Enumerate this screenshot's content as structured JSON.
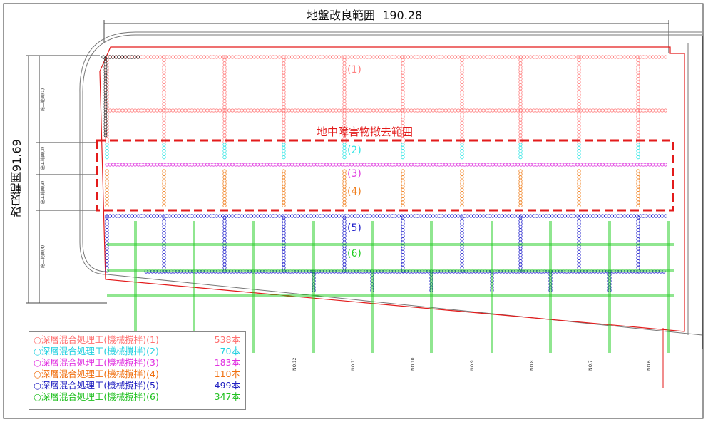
{
  "title": {
    "width_label": "地盤改良範囲",
    "width_value": "190.28"
  },
  "side_label": "改良範囲91.69",
  "obstacle_label": "地中障害物撤去範囲",
  "zones": [
    {
      "label": "(1)",
      "color": "#ff8080"
    },
    {
      "label": "(2)",
      "color": "#33e5e5"
    },
    {
      "label": "(3)",
      "color": "#e040e0"
    },
    {
      "label": "(4)",
      "color": "#f08020"
    },
    {
      "label": "(5)",
      "color": "#2222cc"
    },
    {
      "label": "(6)",
      "color": "#22cc22"
    }
  ],
  "legend": [
    {
      "label": "○深層混合処理工(機械撹拌)(1)",
      "count": "538本",
      "color": "#ff7070"
    },
    {
      "label": "○深層混合処理工(機械撹拌)(2)",
      "count": "70本",
      "color": "#22d0e0"
    },
    {
      "label": "○深層混合処理工(機械撹拌)(3)",
      "count": "183本",
      "color": "#e030e0"
    },
    {
      "label": "○深層混合処理工(機械撹拌)(4)",
      "count": "110本",
      "color": "#f07010"
    },
    {
      "label": "○深層混合処理工(機械撹拌)(5)",
      "count": "499本",
      "color": "#2020c0"
    },
    {
      "label": "○深層混合処理工(機械撹拌)(6)",
      "count": "347本",
      "color": "#20c020"
    }
  ],
  "station_labels": [
    "NO.12",
    "NO.11",
    "NO.10",
    "NO.9",
    "NO.8",
    "NO.7",
    "NO.6"
  ],
  "section_labels": [
    "施工範囲(1)",
    "施工範囲(2)",
    "施工範囲(3)",
    "施工範囲(4)"
  ],
  "colors": {
    "boundary": "#e31b1b",
    "frame": "#333333",
    "outline": "#777777"
  }
}
